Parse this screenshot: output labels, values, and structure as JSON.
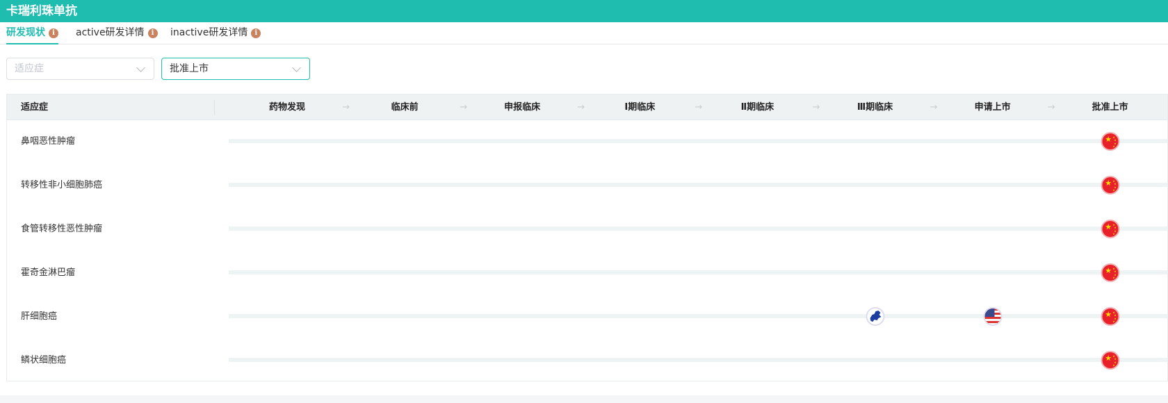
{
  "header": {
    "title": "卡瑞利珠单抗"
  },
  "tabs": [
    {
      "label": "研发现状",
      "active": true
    },
    {
      "label": "active研发详情"
    },
    {
      "label": "inactive研发详情"
    }
  ],
  "filters": {
    "indication_placeholder": "适应症",
    "stage_value": "批准上市"
  },
  "table": {
    "first_col": "适应症",
    "stages": [
      "药物发现",
      "临床前",
      "申报临床",
      "Ⅰ期临床",
      "Ⅱ期临床",
      "Ⅲ期临床",
      "申请上市",
      "批准上市"
    ],
    "rows": [
      {
        "indication": "鼻咽恶性肿瘤",
        "flags": [
          {
            "stage": 7,
            "region": "china"
          }
        ]
      },
      {
        "indication": "转移性非小细胞肺癌",
        "flags": [
          {
            "stage": 7,
            "region": "china"
          }
        ]
      },
      {
        "indication": "食管转移性恶性肿瘤",
        "flags": [
          {
            "stage": 7,
            "region": "china"
          }
        ]
      },
      {
        "indication": "霍奇金淋巴瘤",
        "flags": [
          {
            "stage": 7,
            "region": "china"
          }
        ]
      },
      {
        "indication": "肝细胞癌",
        "flags": [
          {
            "stage": 5,
            "region": "eu"
          },
          {
            "stage": 6,
            "region": "us"
          },
          {
            "stage": 7,
            "region": "china"
          }
        ]
      },
      {
        "indication": "鳞状细胞癌",
        "flags": [
          {
            "stage": 7,
            "region": "china"
          }
        ]
      }
    ]
  },
  "colors": {
    "brand": "#1fbcb0",
    "info": "#c9835e",
    "china": "#e8202a"
  }
}
